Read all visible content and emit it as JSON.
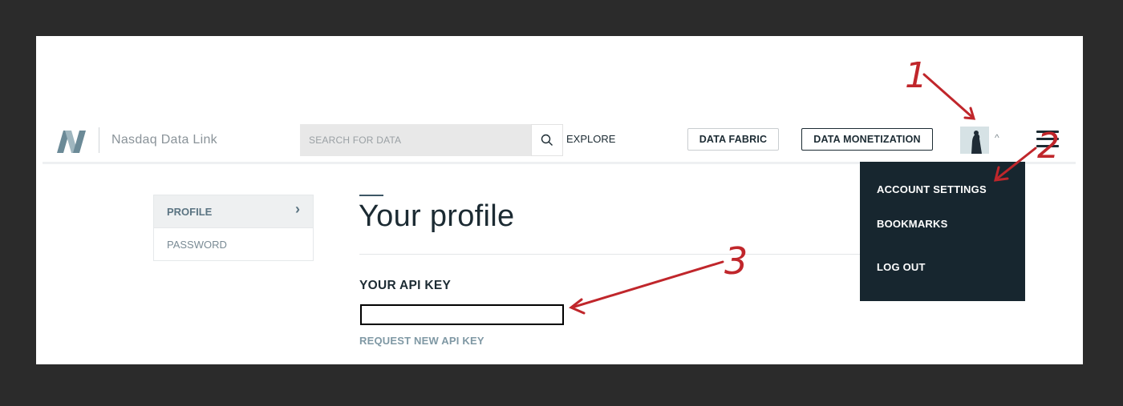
{
  "header": {
    "brand": "Nasdaq Data Link",
    "search_placeholder": "SEARCH FOR DATA",
    "explore": "EXPLORE",
    "data_fabric": "DATA FABRIC",
    "data_monetization": "DATA MONETIZATION"
  },
  "sidebar": {
    "items": [
      {
        "label": "PROFILE",
        "active": true
      },
      {
        "label": "PASSWORD",
        "active": false
      }
    ]
  },
  "main": {
    "title": "Your profile",
    "api_key_label": "YOUR API KEY",
    "api_key_value": "",
    "request_new": "REQUEST NEW API KEY"
  },
  "account_menu": {
    "items": [
      "ACCOUNT SETTINGS",
      "BOOKMARKS",
      "LOG OUT"
    ]
  },
  "annotations": {
    "markers": [
      "1",
      "2",
      "3"
    ],
    "color": "#c0262b"
  },
  "colors": {
    "dark": "#1c2b33",
    "dropdown_bg": "#17262f",
    "link": "#7f98a4"
  }
}
